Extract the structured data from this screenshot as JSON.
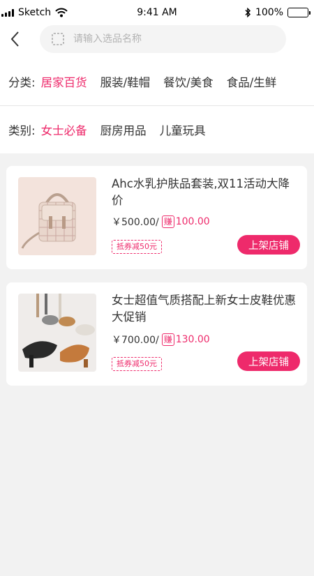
{
  "status_bar": {
    "carrier": "Sketch",
    "time": "9:41 AM",
    "battery": "100%",
    "battery_level": 1.0
  },
  "search": {
    "placeholder": "请输入选品名称",
    "value": ""
  },
  "category_filter": {
    "label": "分类:",
    "items": [
      {
        "label": "居家百货",
        "active": true
      },
      {
        "label": "服装/鞋帽",
        "active": false
      },
      {
        "label": "餐饮/美食",
        "active": false
      },
      {
        "label": "食品/生鲜",
        "active": false
      }
    ]
  },
  "type_filter": {
    "label": "类别:",
    "items": [
      {
        "label": "女士必备",
        "active": true
      },
      {
        "label": "厨房用品",
        "active": false
      },
      {
        "label": "儿童玩具",
        "active": false
      }
    ]
  },
  "products": [
    {
      "title": "Ahc水乳护肤品套装,双11活动大降价",
      "price": "￥500.00/",
      "earn_badge": "赚",
      "earn_amount": "100.00",
      "coupon": "抵券减50元",
      "button_label": "上架店铺",
      "image_icon": "handbag-image"
    },
    {
      "title": "女士超值气质搭配上新女士皮鞋优惠大促销",
      "price": "￥700.00/",
      "earn_badge": "赚",
      "earn_amount": "130.00",
      "coupon": "抵券减50元",
      "button_label": "上架店铺",
      "image_icon": "shoes-image"
    }
  ],
  "colors": {
    "accent": "#ee2a6b",
    "background": "#f2f2f2"
  }
}
